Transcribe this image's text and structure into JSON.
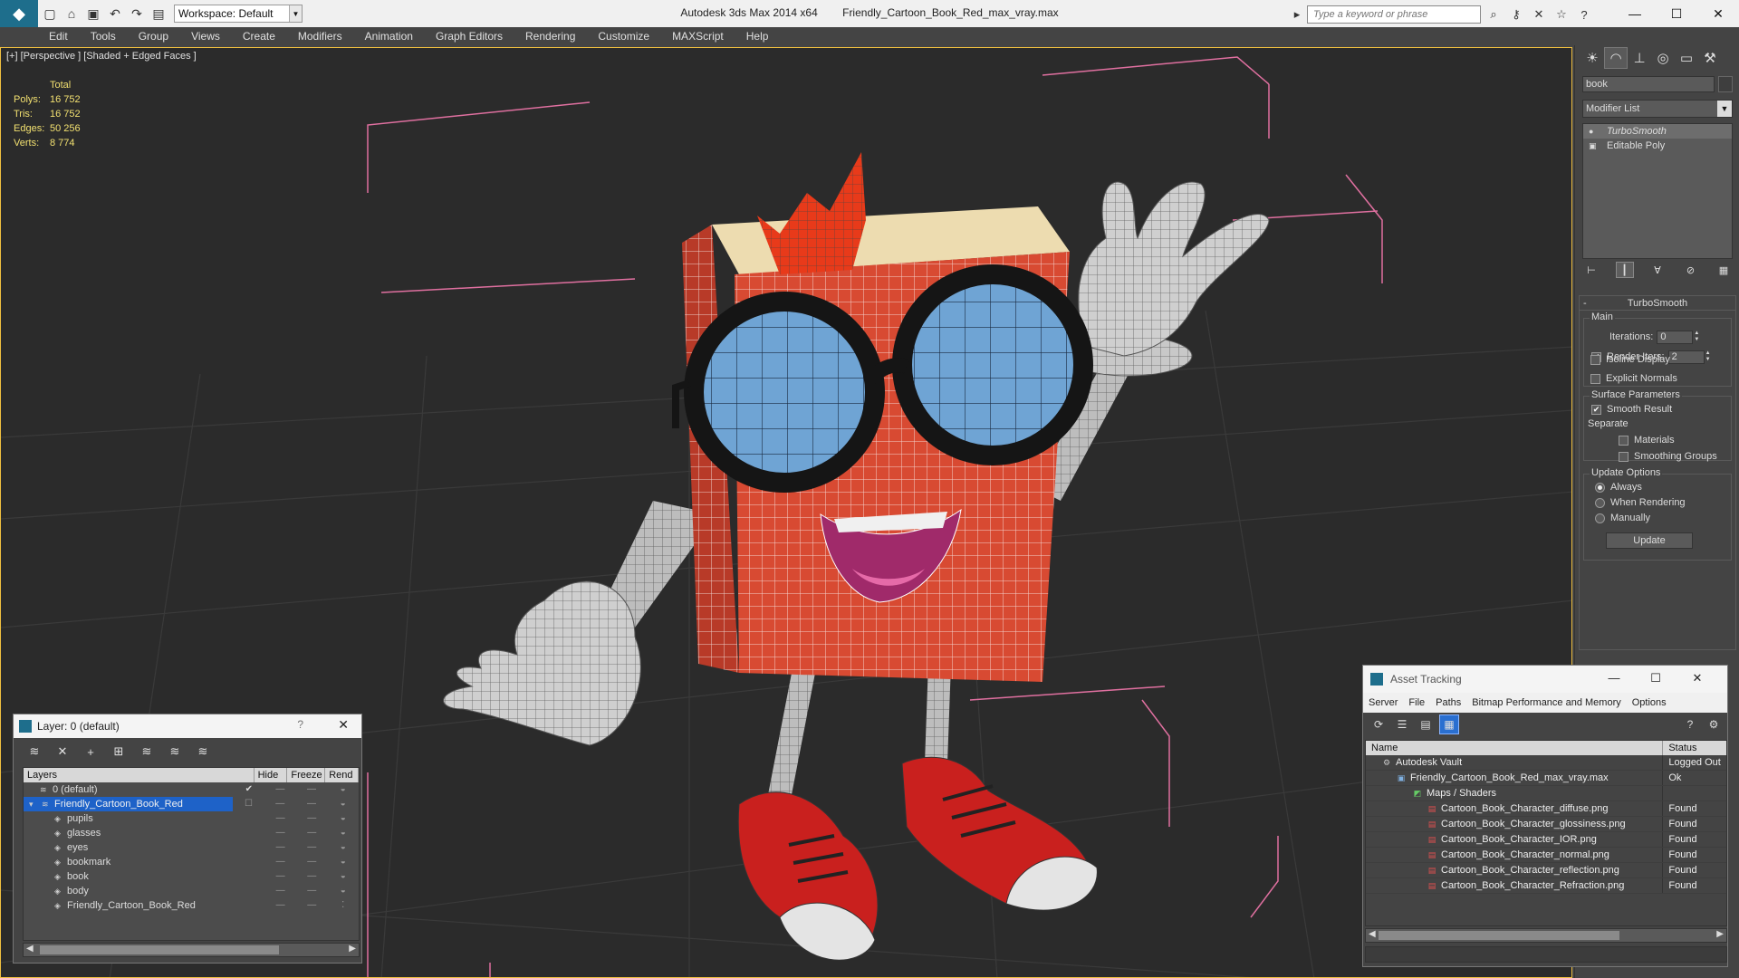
{
  "app": {
    "name": "Autodesk 3ds Max  2014 x64",
    "file": "Friendly_Cartoon_Book_Red_max_vray.max",
    "workspace": "Workspace: Default",
    "search_placeholder": "Type a keyword or phrase"
  },
  "menu": [
    "Edit",
    "Tools",
    "Group",
    "Views",
    "Create",
    "Modifiers",
    "Animation",
    "Graph Editors",
    "Rendering",
    "Customize",
    "MAXScript",
    "Help"
  ],
  "viewport": {
    "label": "[+] [Perspective ] [Shaded + Edged Faces ]",
    "stats_header": "Total",
    "stats": [
      {
        "label": "Polys:",
        "value": "16 752"
      },
      {
        "label": "Tris:",
        "value": "16 752"
      },
      {
        "label": "Edges:",
        "value": "50 256"
      },
      {
        "label": "Verts:",
        "value": "8 774"
      }
    ]
  },
  "command_panel": {
    "object_name": "book",
    "modifier_list": "Modifier List",
    "stack": [
      "TurboSmooth",
      "Editable Poly"
    ],
    "rollout_title": "TurboSmooth",
    "main_group": "Main",
    "iterations_label": "Iterations:",
    "iterations_value": "0",
    "render_iters_label": "Render Iters:",
    "render_iters_value": "2",
    "isoline": "Isoline Display",
    "explicit_normals": "Explicit Normals",
    "surface_group": "Surface Parameters",
    "smooth_result": "Smooth Result",
    "separate": "Separate",
    "materials": "Materials",
    "smoothing_groups": "Smoothing Groups",
    "update_group": "Update Options",
    "always": "Always",
    "when_rendering": "When Rendering",
    "manually": "Manually",
    "update_button": "Update"
  },
  "layer_window": {
    "title": "Layer: 0 (default)",
    "help": "?",
    "columns": [
      "Layers",
      "Hide",
      "Freeze",
      "Rend"
    ],
    "rows": [
      {
        "name": "0 (default)",
        "indent": 1
      },
      {
        "name": "Friendly_Cartoon_Book_Red",
        "indent": 1
      },
      {
        "name": "pupils",
        "indent": 2
      },
      {
        "name": "glasses",
        "indent": 2
      },
      {
        "name": "eyes",
        "indent": 2
      },
      {
        "name": "bookmark",
        "indent": 2
      },
      {
        "name": "book",
        "indent": 2
      },
      {
        "name": "body",
        "indent": 2
      },
      {
        "name": "Friendly_Cartoon_Book_Red",
        "indent": 2
      }
    ]
  },
  "asset_tracking": {
    "title": "Asset Tracking",
    "menu": [
      "Server",
      "File",
      "Paths",
      "Bitmap Performance and Memory",
      "Options"
    ],
    "columns": [
      "Name",
      "Status"
    ],
    "rows": [
      {
        "name": "Autodesk Vault",
        "status": "Logged Out",
        "icon": "vault-icon",
        "indent": 1
      },
      {
        "name": "Friendly_Cartoon_Book_Red_max_vray.max",
        "status": "Ok",
        "icon": "max-file-icon",
        "indent": 2
      },
      {
        "name": "Maps / Shaders",
        "status": "",
        "icon": "maps-icon",
        "indent": 3
      },
      {
        "name": "Cartoon_Book_Character_diffuse.png",
        "status": "Found",
        "icon": "png-icon",
        "indent": 4
      },
      {
        "name": "Cartoon_Book_Character_glossiness.png",
        "status": "Found",
        "icon": "png-icon",
        "indent": 4
      },
      {
        "name": "Cartoon_Book_Character_IOR.png",
        "status": "Found",
        "icon": "png-icon",
        "indent": 4
      },
      {
        "name": "Cartoon_Book_Character_normal.png",
        "status": "Found",
        "icon": "png-icon",
        "indent": 4
      },
      {
        "name": "Cartoon_Book_Character_reflection.png",
        "status": "Found",
        "icon": "png-icon",
        "indent": 4
      },
      {
        "name": "Cartoon_Book_Character_Refraction.png",
        "status": "Found",
        "icon": "png-icon",
        "indent": 4
      }
    ]
  },
  "colors": {
    "viewport_bg": "#2b2b2b",
    "ui_bg": "#444444",
    "book_red": "#d84a32",
    "lens_blue": "#6fa4d4",
    "selection_blue": "#1e62c8",
    "bbox_pink": "#e070a0"
  }
}
